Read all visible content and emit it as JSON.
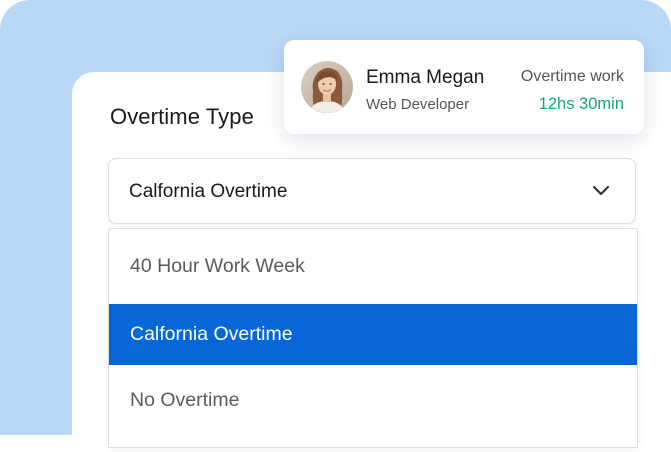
{
  "overtime_form": {
    "title": "Overtime Type",
    "selected_value": "Calfornia Overtime",
    "options": [
      {
        "label": "40 Hour Work Week",
        "selected": false
      },
      {
        "label": "Calfornia Overtime",
        "selected": true
      },
      {
        "label": "No Overtime",
        "selected": false
      }
    ],
    "dropdown_icon": "chevron-down-icon"
  },
  "profile": {
    "name": "Emma Megan",
    "role": "Web Developer",
    "overtime_label": "Overtime work",
    "overtime_value": "12hs 30min",
    "overtime_value_color": "#17a67a",
    "avatar_icon": "avatar"
  },
  "colors": {
    "background_accent": "#b9d8f6",
    "selected_option_bg": "#0867d7",
    "selected_option_text": "#ffffff"
  }
}
